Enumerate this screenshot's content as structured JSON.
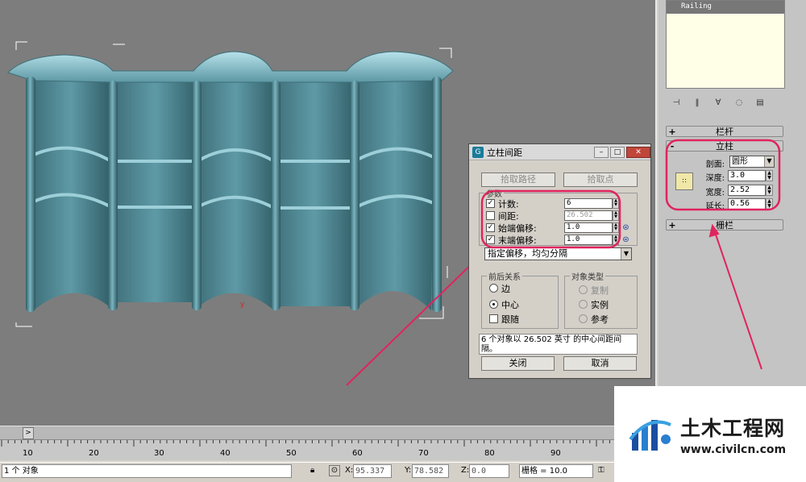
{
  "command_panel": {
    "modifier_top_item": "Railing",
    "rollouts": {
      "railing": "栏杆",
      "posts": "立柱",
      "fencing": "栅栏"
    },
    "posts": {
      "section_label": "剖面:",
      "section_value": "圆形",
      "depth_label": "深度:",
      "depth_value": "3.0",
      "width_label": "宽度:",
      "width_value": "2.52",
      "extension_label": "延长:",
      "extension_value": "0.56"
    }
  },
  "dialog": {
    "title": "立柱间距",
    "pick_path": "拾取路径",
    "pick_points": "拾取点",
    "params_group": "参数",
    "count_label": "计数:",
    "count_value": "6",
    "count_checked": true,
    "spacing_label": "间距:",
    "spacing_value": "26.502",
    "spacing_checked": false,
    "start_offset_label": "始端偏移:",
    "start_offset_value": "1.0",
    "start_offset_checked": true,
    "end_offset_label": "末端偏移:",
    "end_offset_value": "1.0",
    "end_offset_checked": true,
    "distribution": "指定偏移，均匀分隔",
    "context_group": "前后关系",
    "edges": "边",
    "centers": "中心",
    "follow": "跟随",
    "object_type_group": "对象类型",
    "copy": "复制",
    "instance": "实例",
    "reference": "参考",
    "summary": "6 个对象以 26.502 英寸 的中心间距间隔。",
    "close": "关闭",
    "cancel": "取消"
  },
  "timeline": {
    "slider_icon": ">",
    "ticks": [
      "10",
      "20",
      "30",
      "40",
      "50",
      "60",
      "70",
      "80",
      "90"
    ]
  },
  "status": {
    "selected": "1 个 对象",
    "x_label": "X:",
    "x_value": "95.337",
    "y_label": "Y:",
    "y_value": "78.582",
    "z_label": "Z:",
    "z_value": "0.0",
    "grid": "栅格 = 10.0"
  },
  "watermark": {
    "name": "土木工程网",
    "url": "www.civilcn.com"
  },
  "colors": {
    "highlight": "#e0245e",
    "mesh": "#5e9aa6",
    "viewport_bg": "#7d7d7d"
  }
}
